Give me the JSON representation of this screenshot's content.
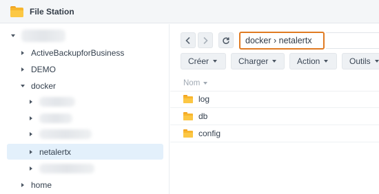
{
  "app": {
    "title": "File Station"
  },
  "sidebar": {
    "items": [
      {
        "label": "ActiveBackupforBusiness"
      },
      {
        "label": "DEMO"
      },
      {
        "label": "docker"
      },
      {
        "label": "netalertx"
      },
      {
        "label": "home"
      }
    ]
  },
  "toolbar": {
    "path": "docker › netalertx",
    "buttons": [
      {
        "label": "Créer"
      },
      {
        "label": "Charger"
      },
      {
        "label": "Action"
      },
      {
        "label": "Outils"
      }
    ]
  },
  "list": {
    "column_name": "Nom",
    "files": [
      {
        "name": "log"
      },
      {
        "name": "db"
      },
      {
        "name": "config"
      }
    ]
  },
  "colors": {
    "accent_outline": "#e07a21",
    "selected_bg": "#e3f0fb",
    "folder": "#f8b62e"
  },
  "icons": [
    "folder-icon",
    "back-arrow-icon",
    "forward-arrow-icon",
    "refresh-icon",
    "caret-icon"
  ]
}
